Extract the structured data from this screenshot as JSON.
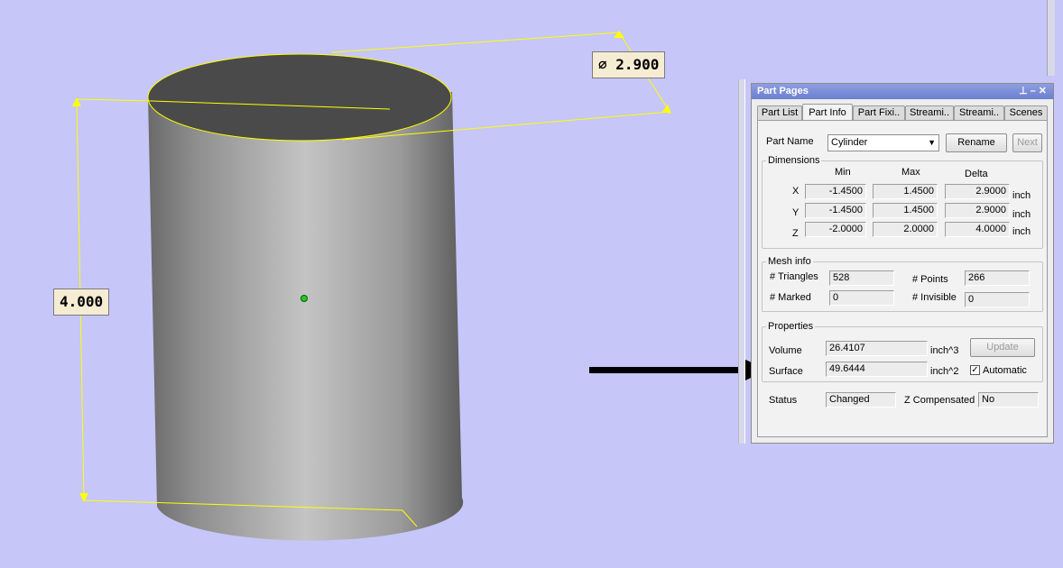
{
  "viewport": {
    "diameter_label": "⌀ 2.900",
    "height_label": "4.000"
  },
  "panel": {
    "title": "Part Pages",
    "title_icons": [
      "pin-icon",
      "minimize-icon",
      "close-icon"
    ],
    "tabs": [
      "Part List",
      "Part Info",
      "Part Fixi..",
      "Streami..",
      "Streami..",
      "Scenes"
    ],
    "active_tab": "Part Info",
    "part_name_label": "Part Name",
    "part_name_value": "Cylinder",
    "rename_button": "Rename",
    "next_button": "Next",
    "dimensions": {
      "title": "Dimensions",
      "col_min": "Min",
      "col_max": "Max",
      "col_delta": "Delta",
      "rows": [
        {
          "axis": "X",
          "min": "-1.4500",
          "max": "1.4500",
          "delta": "2.9000",
          "unit": "inch"
        },
        {
          "axis": "Y",
          "min": "-1.4500",
          "max": "1.4500",
          "delta": "2.9000",
          "unit": "inch"
        },
        {
          "axis": "Z",
          "min": "-2.0000",
          "max": "2.0000",
          "delta": "4.0000",
          "unit": "inch"
        }
      ]
    },
    "mesh_info": {
      "title": "Mesh info",
      "triangles_label": "# Triangles",
      "triangles_value": "528",
      "points_label": "# Points",
      "points_value": "266",
      "marked_label": "# Marked",
      "marked_value": "0",
      "invisible_label": "# Invisible",
      "invisible_value": "0"
    },
    "properties": {
      "title": "Properties",
      "volume_label": "Volume",
      "volume_value": "26.4107",
      "volume_unit": "inch^3",
      "surface_label": "Surface",
      "surface_value": "49.6444",
      "surface_unit": "inch^2",
      "update_button": "Update",
      "automatic_label": "Automatic",
      "automatic_checked": true
    },
    "status_label": "Status",
    "status_value": "Changed",
    "z_comp_label": "Z Compensated",
    "z_comp_value": "No"
  },
  "colors": {
    "background": "#c6c6f9",
    "dimension_line": "#ffff00",
    "cylinder_top": "#4a4a4a",
    "center_point": "#22cc22"
  }
}
